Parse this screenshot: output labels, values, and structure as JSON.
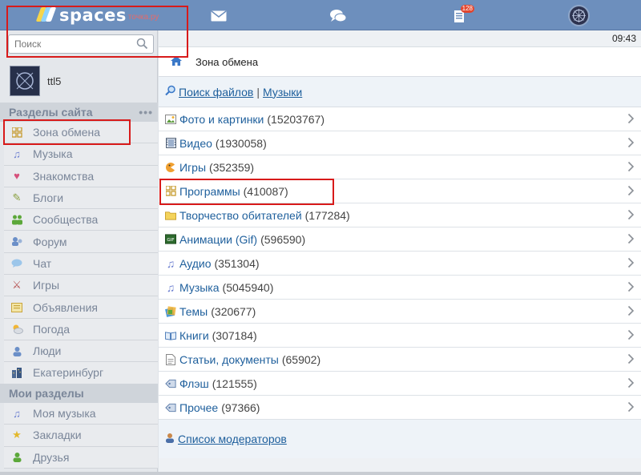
{
  "header": {
    "logo_text": "spaces",
    "logo_sub": "точка.ру",
    "notifications_badge": "128",
    "accent": "#6d8fbd"
  },
  "sidebar": {
    "search_placeholder": "Поиск",
    "user_name": "ttl5",
    "sections_title": "Разделы сайта",
    "sections_more": "•••",
    "items": [
      {
        "label": "Зона обмена",
        "icon": "grid-icon"
      },
      {
        "label": "Музыка",
        "icon": "music-note-icon"
      },
      {
        "label": "Знакомства",
        "icon": "heart-icon"
      },
      {
        "label": "Блоги",
        "icon": "pencil-icon"
      },
      {
        "label": "Сообщества",
        "icon": "people-icon"
      },
      {
        "label": "Форум",
        "icon": "forum-icon"
      },
      {
        "label": "Чат",
        "icon": "chat-bubble-icon"
      },
      {
        "label": "Игры",
        "icon": "crossed-swords-icon"
      },
      {
        "label": "Объявления",
        "icon": "board-icon"
      },
      {
        "label": "Погода",
        "icon": "weather-icon"
      },
      {
        "label": "Люди",
        "icon": "person-icon"
      },
      {
        "label": "Екатеринбург",
        "icon": "city-icon"
      }
    ],
    "my_title": "Мои разделы",
    "my_items": [
      {
        "label": "Моя музыка",
        "icon": "music-note-icon"
      },
      {
        "label": "Закладки",
        "icon": "star-icon"
      },
      {
        "label": "Друзья",
        "icon": "person-icon"
      }
    ]
  },
  "main": {
    "time": "09:43",
    "breadcrumb": "Зона обмена",
    "search_files": "Поиск файлов",
    "links_sep": "|",
    "music_link": "Музыки",
    "categories": [
      {
        "name": "Фото и картинки",
        "count": "(15203767)",
        "icon": "photo-icon"
      },
      {
        "name": "Видео",
        "count": "(1930058)",
        "icon": "film-icon"
      },
      {
        "name": "Игры",
        "count": "(352359)",
        "icon": "game-icon"
      },
      {
        "name": "Программы",
        "count": "(410087)",
        "icon": "grid-icon"
      },
      {
        "name": "Творчество обитателей",
        "count": "(177284)",
        "icon": "folder-icon"
      },
      {
        "name": "Анимации (Gif)",
        "count": "(596590)",
        "icon": "gif-icon"
      },
      {
        "name": "Аудио",
        "count": "(351304)",
        "icon": "music-note-icon"
      },
      {
        "name": "Музыка",
        "count": "(5045940)",
        "icon": "music-note-icon"
      },
      {
        "name": "Темы",
        "count": "(320677)",
        "icon": "theme-icon"
      },
      {
        "name": "Книги",
        "count": "(307184)",
        "icon": "book-icon"
      },
      {
        "name": "Статьи, документы",
        "count": "(65902)",
        "icon": "document-icon"
      },
      {
        "name": "Флэш",
        "count": "(121555)",
        "icon": "tag-icon"
      },
      {
        "name": "Прочее",
        "count": "(97366)",
        "icon": "tag-icon"
      }
    ],
    "moderators": "Список модераторов"
  }
}
